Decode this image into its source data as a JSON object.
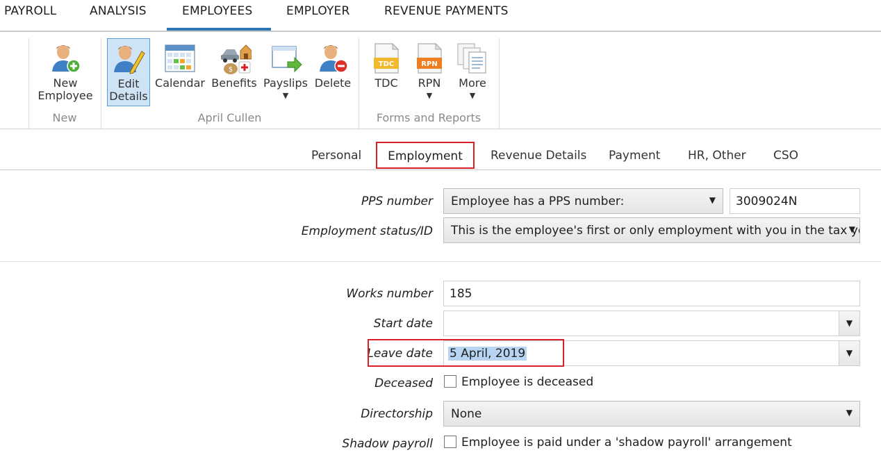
{
  "topnav": {
    "tabs": [
      "PAYROLL",
      "ANALYSIS",
      "EMPLOYEES",
      "EMPLOYER",
      "REVENUE PAYMENTS"
    ],
    "active": "EMPLOYEES"
  },
  "ribbon": {
    "new_group": {
      "label": "New",
      "new_employee": {
        "line1": "New",
        "line2": "Employee"
      }
    },
    "employee_group": {
      "label": "April Cullen",
      "edit_details": {
        "line1": "Edit",
        "line2": "Details"
      },
      "calendar": "Calendar",
      "benefits": "Benefits",
      "payslips": "Payslips",
      "delete": "Delete"
    },
    "forms_group": {
      "label": "Forms and Reports",
      "tdc": "TDC",
      "tdc_badge": "TDC",
      "rpn": "RPN",
      "rpn_badge": "RPN",
      "more": "More"
    },
    "caret": "▼"
  },
  "subtabs": {
    "items": [
      "Personal",
      "Employment",
      "Revenue Details",
      "Payment",
      "HR, Other",
      "CSO"
    ],
    "active": "Employment"
  },
  "form": {
    "pps_number": {
      "label": "PPS number",
      "type_value": "Employee has a PPS number:",
      "number_value": "3009024N"
    },
    "employment_status": {
      "label": "Employment status/ID",
      "value": "This is the employee's first or only employment with you in the tax year."
    },
    "works_number": {
      "label": "Works number",
      "value": "185"
    },
    "start_date": {
      "label": "Start date",
      "value": ""
    },
    "leave_date": {
      "label": "Leave date",
      "value": "5 April, 2019"
    },
    "deceased": {
      "label": "Deceased",
      "checkbox_text": "Employee is deceased",
      "checked": false
    },
    "directorship": {
      "label": "Directorship",
      "value": "None"
    },
    "shadow_payroll": {
      "label": "Shadow payroll",
      "checkbox_text": "Employee is paid under a 'shadow payroll' arrangement",
      "checked": false
    }
  },
  "colors": {
    "accent": "#2e75b6",
    "highlight": "#d9202a",
    "selection": "#b7d4f2"
  }
}
